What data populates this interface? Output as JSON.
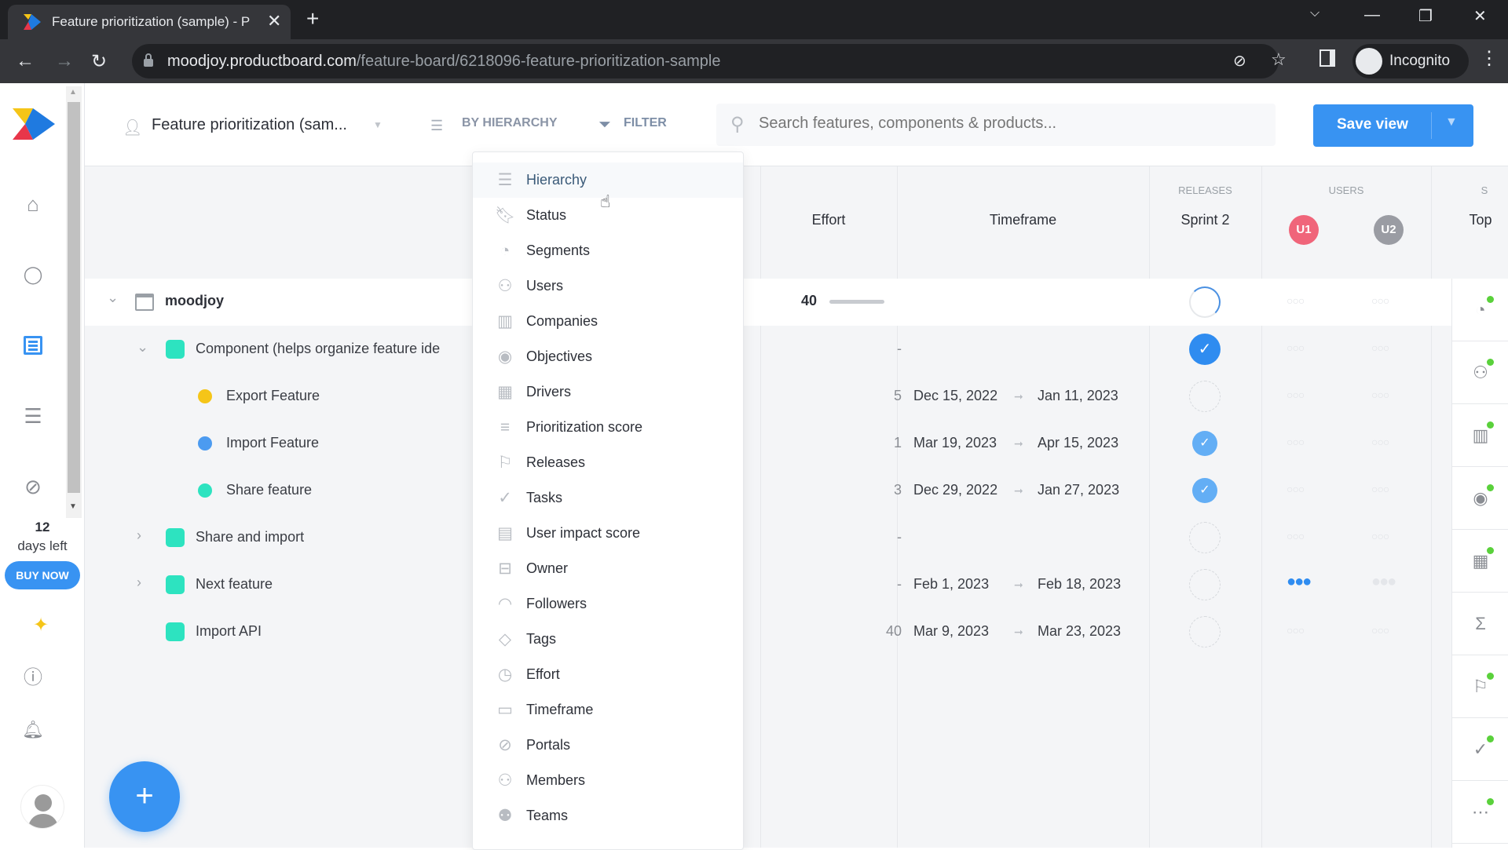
{
  "browser": {
    "tab_title": "Feature prioritization (sample) - P",
    "new_tab": "+",
    "url_host": "moodjoy.productboard.com",
    "url_path": "/feature-board/6218096-feature-prioritization-sample",
    "profile_label": "Incognito"
  },
  "sidebar": {
    "items": [
      {
        "name": "home",
        "icon": "home-icon"
      },
      {
        "name": "insights",
        "icon": "lightbulb-icon"
      },
      {
        "name": "features",
        "icon": "board-icon",
        "active": true
      },
      {
        "name": "roadmaps",
        "icon": "roadmap-icon"
      },
      {
        "name": "portal",
        "icon": "portal-icon"
      }
    ],
    "trial_days": "12",
    "trial_label": "days left",
    "buy_now": "BUY NOW"
  },
  "header": {
    "board_title": "Feature prioritization (sam...",
    "group_by": "BY HIERARCHY",
    "filter": "FILTER",
    "search_placeholder": "Search features, components & products...",
    "save_view": "Save view"
  },
  "columns": {
    "effort": "Effort",
    "timeframe": "Timeframe",
    "releases_group": "RELEASES",
    "sprint": "Sprint 2",
    "users_group": "USERS",
    "user1": "U1",
    "user2": "U2",
    "next_group": "S",
    "next_col": "Top"
  },
  "rows": [
    {
      "name": "moodjoy",
      "level": 0,
      "effort": "40",
      "start": "",
      "end": "",
      "release": "partial"
    },
    {
      "name": "Component (helps organize feature ide",
      "level": 1,
      "effort": "-",
      "start": "",
      "end": "",
      "release": "checked"
    },
    {
      "name": "Export Feature",
      "level": 2,
      "dot": "#f5c518",
      "effort": "5",
      "start": "Dec 15, 2022",
      "end": "Jan 11, 2023",
      "release": "empty"
    },
    {
      "name": "Import Feature",
      "level": 2,
      "dot": "#4c9bf0",
      "effort": "1",
      "start": "Mar 19, 2023",
      "end": "Apr 15, 2023",
      "release": "checked-light"
    },
    {
      "name": "Share feature",
      "level": 2,
      "dot": "#2de3c0",
      "effort": "3",
      "start": "Dec 29, 2022",
      "end": "Jan 27, 2023",
      "release": "checked-light"
    },
    {
      "name": "Share and import",
      "level": 1,
      "effort": "-",
      "start": "",
      "end": "",
      "release": "empty"
    },
    {
      "name": "Next feature",
      "level": 1,
      "effort": "-",
      "start": "Feb 1, 2023",
      "end": "Feb 18, 2023",
      "release": "empty",
      "user1_importance": 3
    },
    {
      "name": "Import API",
      "level": 1,
      "effort": "40",
      "start": "Mar 9, 2023",
      "end": "Mar 23, 2023",
      "release": "empty"
    }
  ],
  "group_by_menu": {
    "items": [
      {
        "label": "Hierarchy",
        "icon": "hierarchy-icon",
        "active": true
      },
      {
        "label": "Status",
        "icon": "bookmark-icon"
      },
      {
        "label": "Segments",
        "icon": "pie-icon"
      },
      {
        "label": "Users",
        "icon": "user-icon"
      },
      {
        "label": "Companies",
        "icon": "building-icon"
      },
      {
        "label": "Objectives",
        "icon": "target-icon"
      },
      {
        "label": "Drivers",
        "icon": "calculator-icon"
      },
      {
        "label": "Prioritization score",
        "icon": "score-icon"
      },
      {
        "label": "Releases",
        "icon": "flag-icon"
      },
      {
        "label": "Tasks",
        "icon": "check-circle-icon"
      },
      {
        "label": "User impact score",
        "icon": "clipboard-icon"
      },
      {
        "label": "Owner",
        "icon": "briefcase-icon"
      },
      {
        "label": "Followers",
        "icon": "signal-icon"
      },
      {
        "label": "Tags",
        "icon": "tag-icon"
      },
      {
        "label": "Effort",
        "icon": "clock-icon"
      },
      {
        "label": "Timeframe",
        "icon": "calendar-icon"
      },
      {
        "label": "Portals",
        "icon": "portal-icon"
      },
      {
        "label": "Members",
        "icon": "member-icon"
      },
      {
        "label": "Teams",
        "icon": "team-icon"
      }
    ]
  },
  "right_panel": {
    "items": [
      "segments-icon",
      "users-icon",
      "companies-icon",
      "objectives-icon",
      "drivers-icon",
      "sum-icon",
      "releases-icon",
      "tasks-icon",
      "more-icon"
    ]
  },
  "fab": "+"
}
